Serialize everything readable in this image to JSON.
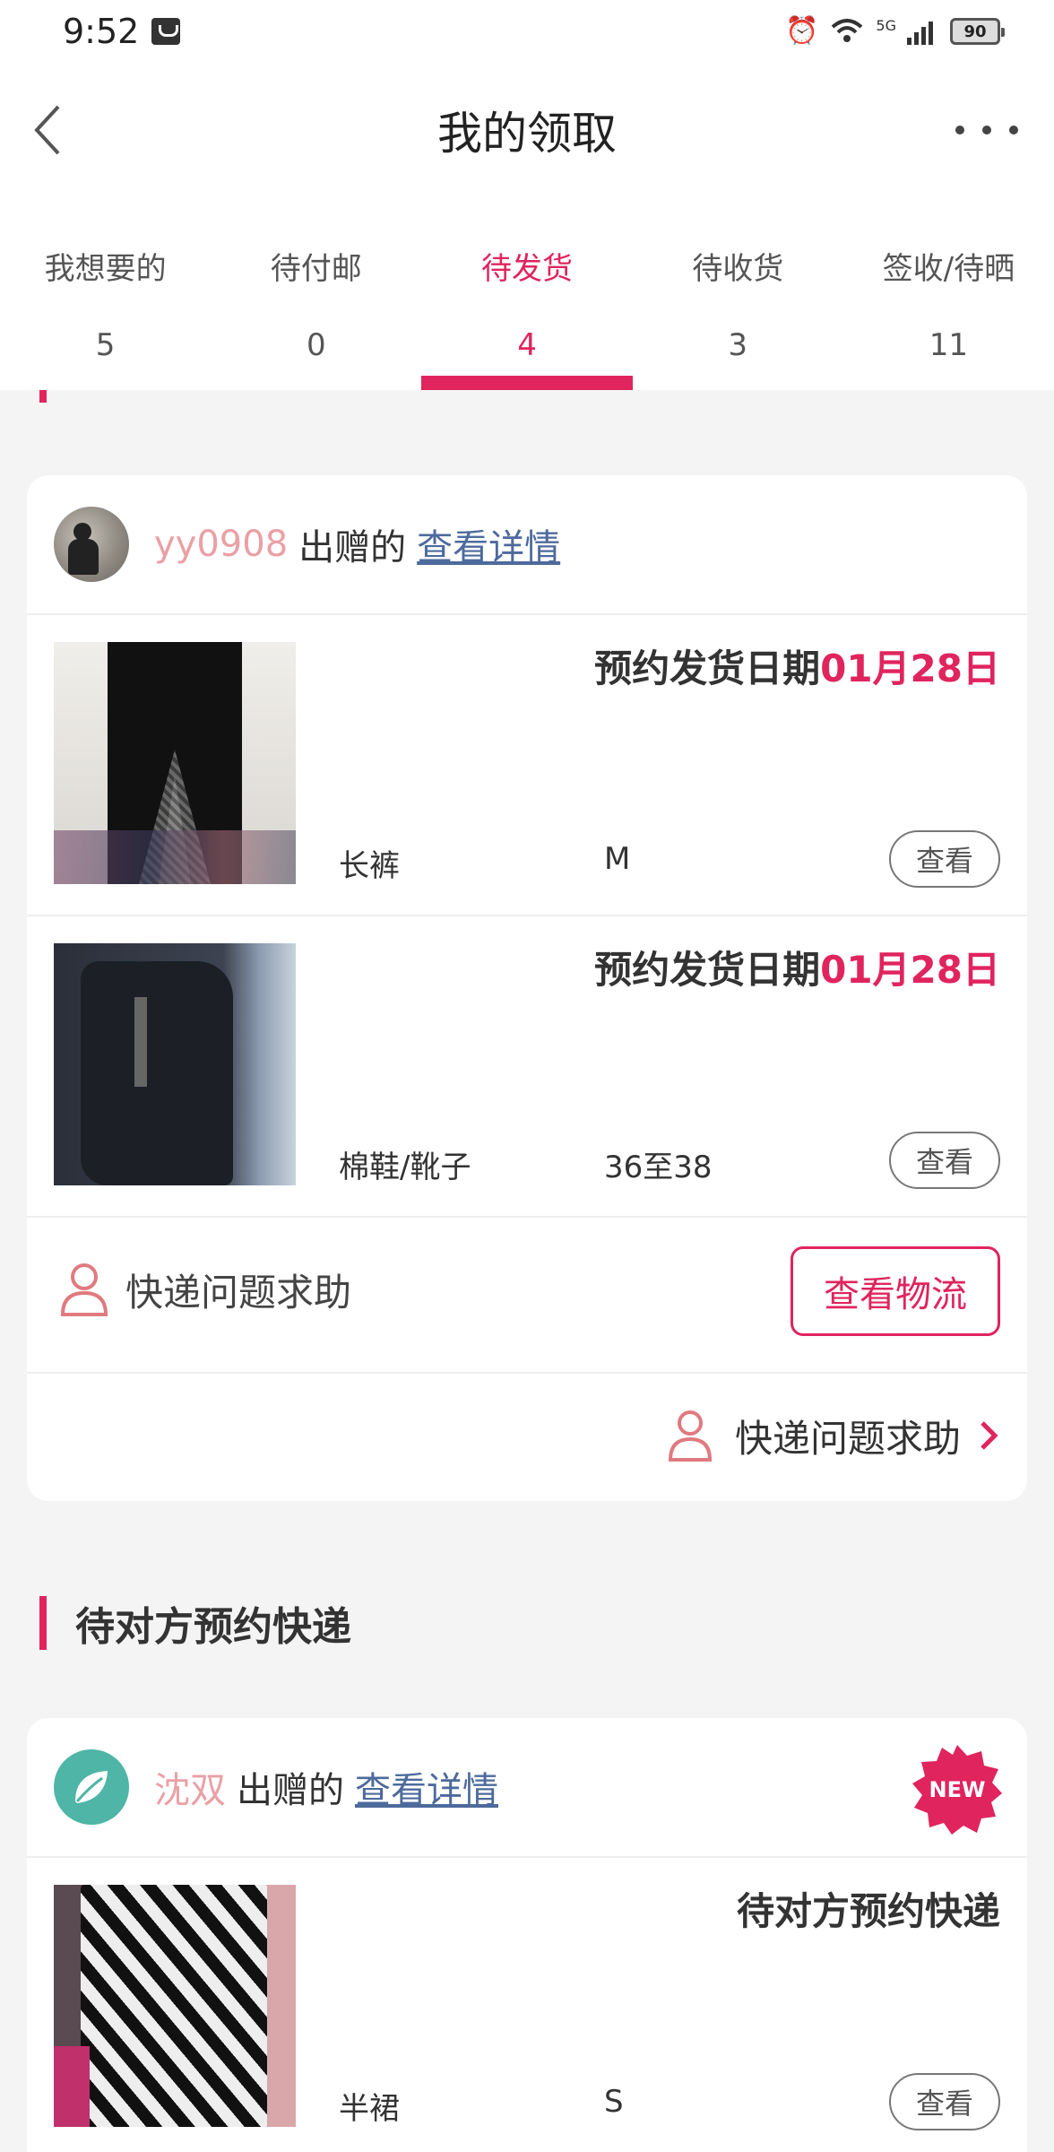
{
  "status_bar": {
    "time": "9:52",
    "battery": "90",
    "network": "5G"
  },
  "nav": {
    "title": "我的领取"
  },
  "tabs": [
    {
      "label": "我想要的",
      "count": "5",
      "active": false
    },
    {
      "label": "待付邮",
      "count": "0",
      "active": false
    },
    {
      "label": "待发货",
      "count": "4",
      "active": true
    },
    {
      "label": "待收货",
      "count": "3",
      "active": false
    },
    {
      "label": "签收/待晒",
      "count": "11",
      "active": false
    }
  ],
  "colors": {
    "accent": "#e0245e",
    "link": "#4d6a9c",
    "username": "#eaa0a5",
    "background": "#f4f4f4"
  },
  "card1": {
    "username": "yy0908",
    "giver_text": "出赠的",
    "detail_link": "查看详情",
    "items": [
      {
        "ship_prefix": "预约发货日期",
        "ship_date": "01月28日",
        "name": "长裤",
        "size": "M",
        "view_label": "查看",
        "thumb_icon": "pants-photo"
      },
      {
        "ship_prefix": "预约发货日期",
        "ship_date": "01月28日",
        "name": "棉鞋/靴子",
        "size": "36至38",
        "view_label": "查看",
        "thumb_icon": "boots-photo"
      }
    ],
    "help_label": "快递问题求助",
    "logistics_label": "查看物流",
    "help_link_label": "快递问题求助"
  },
  "section2": {
    "title": "待对方预约快递"
  },
  "card2": {
    "username": "沈双",
    "giver_text": "出赠的",
    "detail_link": "查看详情",
    "new_badge": "NEW",
    "items": [
      {
        "status": "待对方预约快递",
        "name": "半裙",
        "size": "S",
        "view_label": "查看",
        "thumb_icon": "skirt-photo"
      }
    ]
  }
}
